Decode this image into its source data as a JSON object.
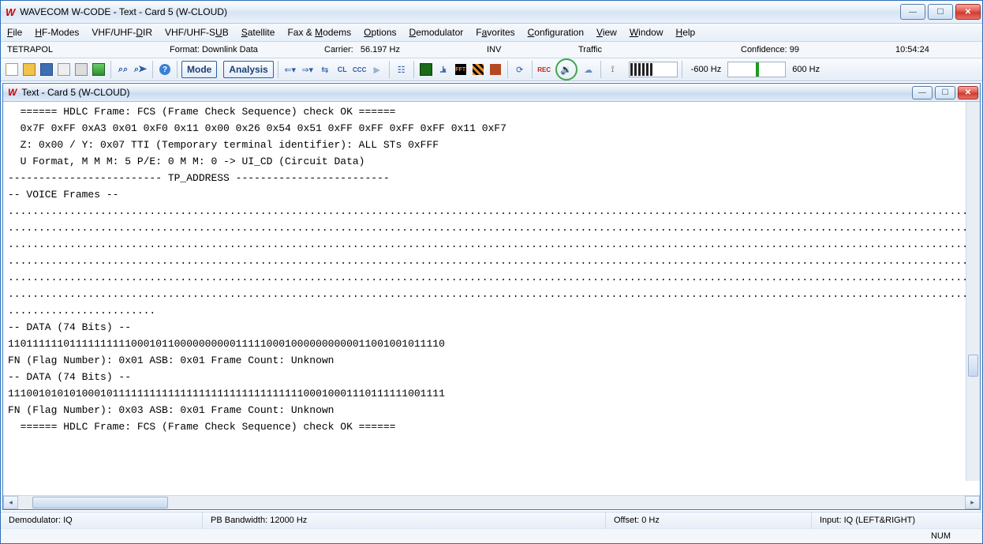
{
  "window": {
    "title": "WAVECOM W-CODE - Text  - Card 5 (W-CLOUD)"
  },
  "menu": {
    "items": [
      "File",
      "HF-Modes",
      "VHF/UHF-DIR",
      "VHF/UHF-SUB",
      "Satellite",
      "Fax & Modems",
      "Options",
      "Demodulator",
      "Favorites",
      "Configuration",
      "View",
      "Window",
      "Help"
    ]
  },
  "info": {
    "mode": "TETRAPOL",
    "format_label": "Format:",
    "format_value": "Downlink Data",
    "carrier_label": "Carrier:",
    "carrier_value": "56.197 Hz",
    "inv": "INV",
    "traffic": "Traffic",
    "confidence_label": "Confidence:",
    "confidence_value": "99",
    "clock": "10:54:24"
  },
  "toolbar": {
    "mode_label": "Mode",
    "analysis_label": "Analysis",
    "neg_hz": "-600 Hz",
    "pos_hz": "600 Hz"
  },
  "child": {
    "title": "Text  - Card 5 (W-CLOUD)"
  },
  "terminal": {
    "lines": [
      "  ====== HDLC Frame: FCS (Frame Check Sequence) check OK ======",
      "  0x7F 0xFF 0xA3 0x01 0xF0 0x11 0x00 0x26 0x54 0x51 0xFF 0xFF 0xFF 0xFF 0x11 0xF7",
      "  Z: 0x00 / Y: 0x07 TTI (Temporary terminal identifier): ALL STs 0xFFF",
      "  U Format, M M M: 5 P/E: 0 M M: 0 -> UI_CD (Circuit Data)",
      "------------------------- TP_ADDRESS -------------------------",
      "",
      "",
      "-- VOICE Frames --",
      "........................................................................................................................................................................",
      "........................................................................................................................................................................",
      "........................................................................................................................................................................",
      "........................................................................................................................................................................",
      "........................................................................................................................................................................",
      "........................................................................................................................................................................",
      "........................",
      "-- DATA (74 Bits) --",
      "11011111101111111111000101100000000001111100010000000000011001001011110",
      "FN (Flag Number): 0x01 ASB: 0x01 Frame Count: Unknown",
      "",
      "-- DATA (74 Bits) --",
      "11100101010100010111111111111111111111111111111100010001110111111001111",
      "FN (Flag Number): 0x03 ASB: 0x01 Frame Count: Unknown",
      "  ====== HDLC Frame: FCS (Frame Check Sequence) check OK ======"
    ]
  },
  "status": {
    "demod": "Demodulator: IQ",
    "pb": "PB Bandwidth: 12000 Hz",
    "offset": "Offset: 0 Hz",
    "input": "Input: IQ (LEFT&RIGHT)",
    "num": "NUM"
  }
}
